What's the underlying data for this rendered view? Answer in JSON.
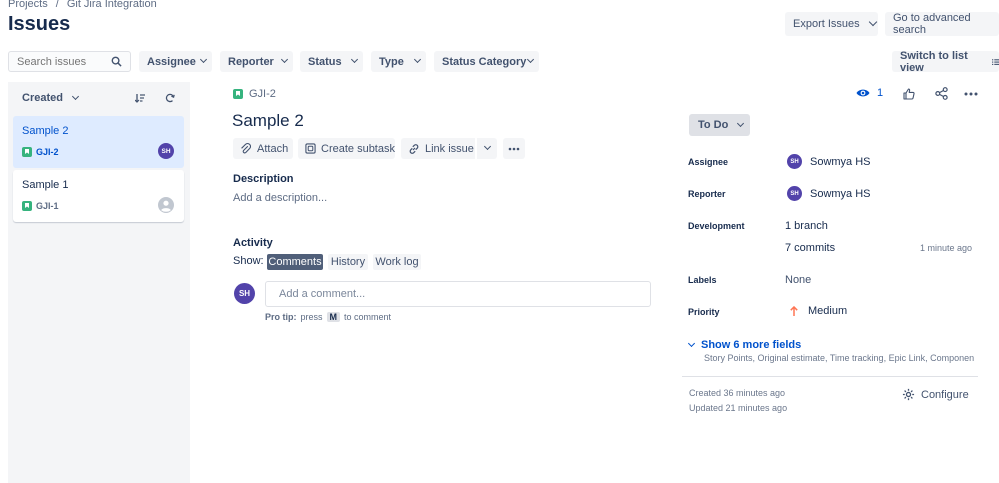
{
  "breadcrumb": {
    "projects": "Projects",
    "sep": "/",
    "project": "Git Jira Integration"
  },
  "page_title": "Issues",
  "header_actions": {
    "export": "Export Issues",
    "advanced": "Go to advanced search"
  },
  "filters": {
    "search_placeholder": "Search issues",
    "assignee": "Assignee",
    "reporter": "Reporter",
    "status": "Status",
    "type": "Type",
    "status_category": "Status Category",
    "switch_view": "Switch to list view"
  },
  "list": {
    "sort_label": "Created",
    "items": [
      {
        "title": "Sample 2",
        "key": "GJI-2",
        "avatar": "SH",
        "selected": true
      },
      {
        "title": "Sample 1",
        "key": "GJI-1",
        "avatar": "",
        "selected": false
      }
    ]
  },
  "issue": {
    "key": "GJI-2",
    "title": "Sample 2",
    "watchers": "1",
    "actions": {
      "attach": "Attach",
      "subtask": "Create subtask",
      "link": "Link issue"
    },
    "description_label": "Description",
    "description_placeholder": "Add a description...",
    "activity_label": "Activity",
    "show_label": "Show:",
    "tabs": [
      "Comments",
      "History",
      "Work log"
    ],
    "comment_avatar": "SH",
    "comment_placeholder": "Add a comment...",
    "protip_prefix": "Pro tip:",
    "protip_press": "press",
    "protip_key": "M",
    "protip_suffix": "to comment"
  },
  "details": {
    "status": "To Do",
    "assignee_label": "Assignee",
    "assignee_initials": "SH",
    "assignee_name": "Sowmya HS",
    "reporter_label": "Reporter",
    "reporter_initials": "SH",
    "reporter_name": "Sowmya HS",
    "development_label": "Development",
    "branch": "1 branch",
    "commits": "7 commits",
    "commits_time": "1 minute ago",
    "labels_label": "Labels",
    "labels_value": "None",
    "priority_label": "Priority",
    "priority_value": "Medium",
    "more_fields": "Show 6 more fields",
    "more_fields_list": "Story Points, Original estimate, Time tracking, Epic Link, Component...",
    "created": "Created 36 minutes ago",
    "updated": "Updated 21 minutes ago",
    "configure": "Configure"
  },
  "colors": {
    "accent": "#0052cc",
    "avatar": "#5243aa",
    "story": "#36b37e",
    "selected_bg": "#deebff",
    "priority": "#ff7452"
  }
}
